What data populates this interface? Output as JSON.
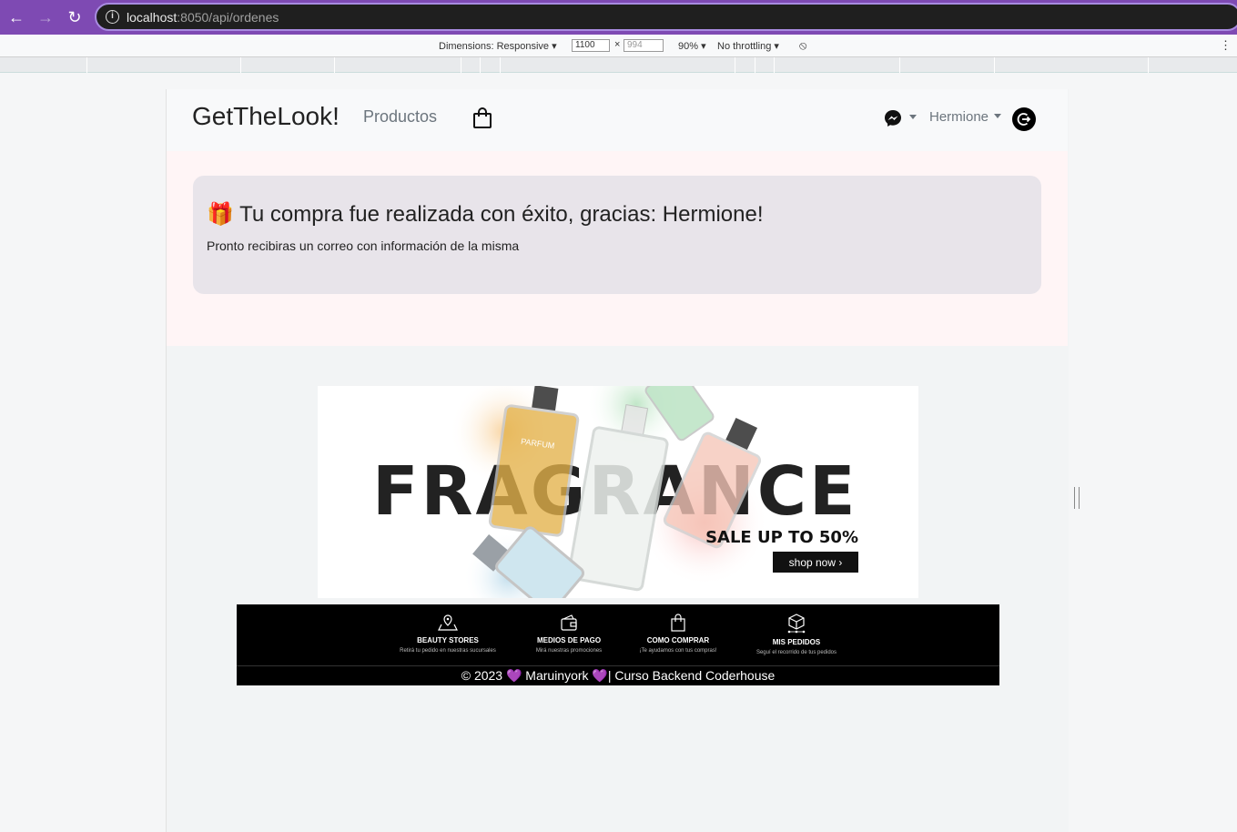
{
  "browser": {
    "url_host": "localhost",
    "url_path": ":8050/api/ordenes"
  },
  "devtools": {
    "dimensions_label": "Dimensions: Responsive",
    "width": "1100",
    "height": "994",
    "zoom": "90%",
    "throttling": "No throttling"
  },
  "navbar": {
    "brand": "GetTheLook!",
    "products_link": "Productos",
    "user_name": "Hermione",
    "icons": [
      "bag-icon",
      "messenger-icon",
      "logout-icon"
    ]
  },
  "alert": {
    "emoji": "🎁",
    "title": "Tu compra fue realizada con éxito, gracias: Hermione!",
    "message": "Pronto recibiras un correo con información de la misma"
  },
  "banner": {
    "headline": "FRAGRANCE",
    "sale_text": "SALE UP TO 50%",
    "cta": "shop now ›",
    "bottle_label": "PARFUM"
  },
  "footer": {
    "features": [
      {
        "title": "BEAUTY STORES",
        "subtitle": "Retirá tu pedido en nuestras sucursales"
      },
      {
        "title": "MEDIOS DE PAGO",
        "subtitle": "Mirá nuestras promociones"
      },
      {
        "title": "COMO COMPRAR",
        "subtitle": "¡Te ayudamos con tus compras!"
      },
      {
        "title": "MIS PEDIDOS",
        "subtitle": "Seguí el recorrido de tus pedidos"
      }
    ],
    "copyright": "© 2023 💜 Maruinyork 💜| Curso Backend Coderhouse"
  },
  "colors": {
    "browser_accent": "#7e4ab3",
    "alert_bg": "#e8e4ea",
    "alert_section_bg": "#fff5f6",
    "footer_bg": "#000000"
  }
}
